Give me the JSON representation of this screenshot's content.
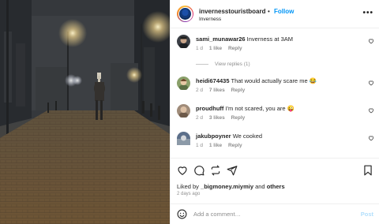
{
  "post": {
    "author": "invernesstouristboard",
    "separator": "•",
    "follow_label": "Follow",
    "location": "Inverness",
    "more_icon": "more-options-icon"
  },
  "comments": [
    {
      "username": "sami_munawar26",
      "text": "Inverness at 3AM",
      "age": "1 d",
      "likes": "1 like",
      "reply_label": "Reply",
      "avatar_color": "#3b3f45"
    },
    {
      "username": "heidi674435",
      "text": "That would actually scare me 😂",
      "age": "2 d",
      "likes": "7 likes",
      "reply_label": "Reply",
      "avatar_color": "#8aa06a"
    },
    {
      "username": "proudhuff",
      "text": "I'm not scared, you are 😜",
      "age": "2 d",
      "likes": "3 likes",
      "reply_label": "Reply",
      "avatar_color": "#a08c7a"
    },
    {
      "username": "jakubpoyner",
      "text": "We cooked",
      "age": "1 d",
      "likes": "1 like",
      "reply_label": "Reply",
      "avatar_color": "#5c6f8a"
    }
  ],
  "view_replies_label": "View replies (1)",
  "liked_by": {
    "prefix": "Liked by ",
    "user": "_bigmoney.miymiy",
    "middle": " and ",
    "others": "others"
  },
  "posted_ago": "2 days ago",
  "add_comment": {
    "placeholder": "Add a comment…",
    "post_label": "Post"
  },
  "colors": {
    "accent": "#0095f6",
    "muted": "#8e8e8e",
    "text": "#262626"
  }
}
